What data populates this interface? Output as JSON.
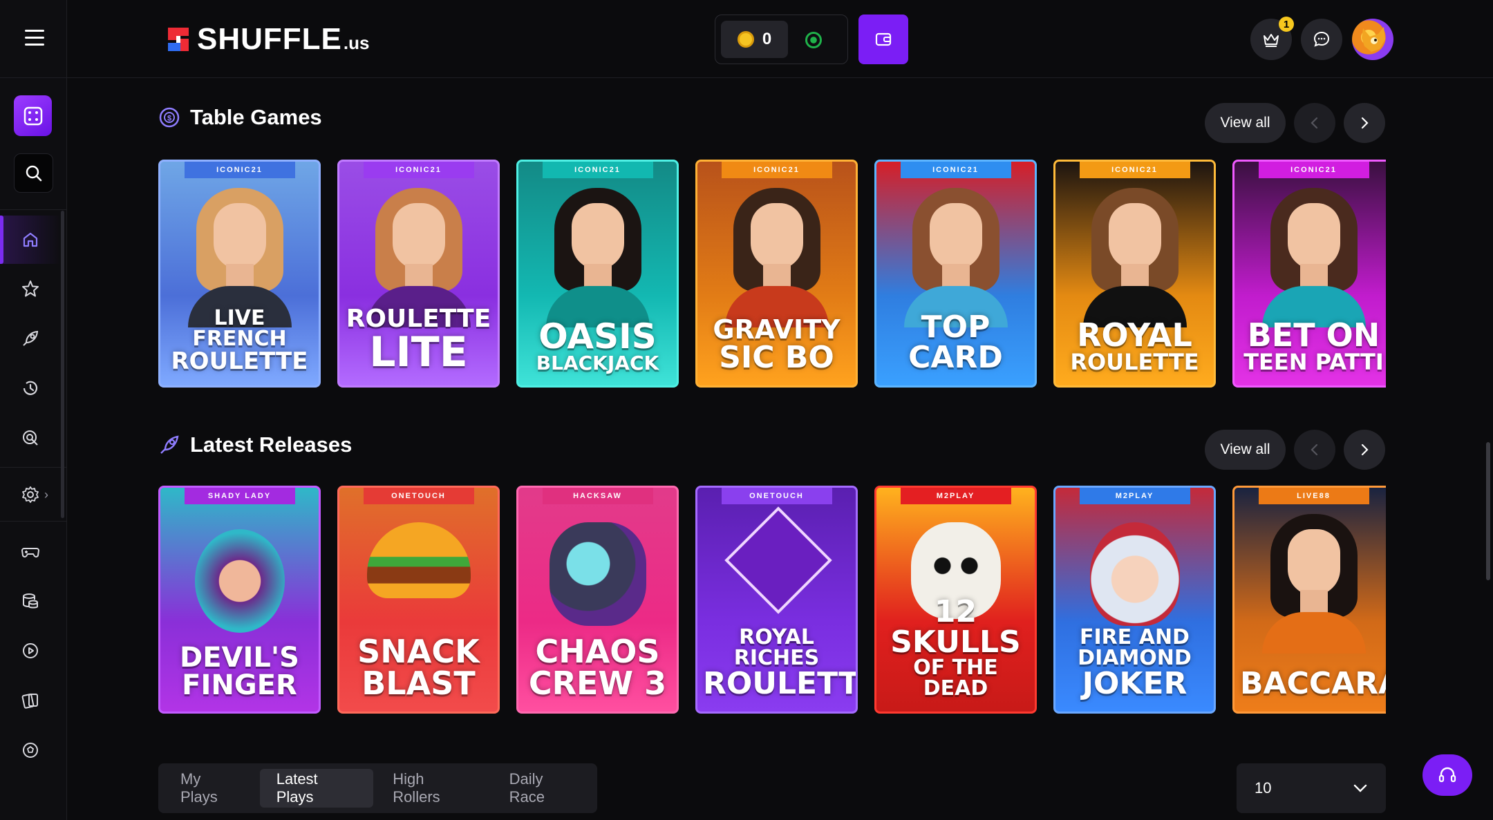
{
  "header": {
    "logo_text": "SHUFFLE",
    "logo_suffix": ".us",
    "balance": "0",
    "notifications_count": "1"
  },
  "sections": [
    {
      "title": "Table Games",
      "view_all": "View all",
      "icon": "casino-chip-icon",
      "games": [
        {
          "provider": "ICONIC21",
          "line1": "Live French",
          "line2": "Roulette",
          "colors": [
            "#6fa6e6",
            "#4c6fd8",
            "#7fa9ff"
          ],
          "border": "#8fb1ff",
          "tag": "#3f72e0",
          "hair": "#d9a063",
          "top": "#2a2f3d"
        },
        {
          "provider": "ICONIC21",
          "line1": "Roulette",
          "line2": "Lite",
          "colors": [
            "#9a4de6",
            "#8a2fe0",
            "#b36bff"
          ],
          "border": "#c07bff",
          "tag": "#9a3cf0",
          "hair": "#c97f4a",
          "top": "#5a1f8a"
        },
        {
          "provider": "ICONIC21",
          "line1": "Oasis",
          "line2": "Blackjack",
          "colors": [
            "#138a86",
            "#13b8b2",
            "#3fe3d8"
          ],
          "border": "#4ff0e4",
          "tag": "#12b8b0",
          "hair": "#1b1412",
          "top": "#0f8f8a"
        },
        {
          "provider": "ICONIC21",
          "line1": "Gravity",
          "line2": "Sic Bo",
          "colors": [
            "#b8521a",
            "#e27c16",
            "#ffa21e"
          ],
          "border": "#ffb236",
          "tag": "#f08a14",
          "hair": "#3a2418",
          "top": "#c83a1c"
        },
        {
          "provider": "ICONIC21",
          "line1": "Top Card",
          "line2": "",
          "colors": [
            "#d61f27",
            "#2f7ee0",
            "#3aa0ff"
          ],
          "border": "#5db5ff",
          "tag": "#2f8ef0",
          "hair": "#8a5030",
          "top": "#3fa8d8"
        },
        {
          "provider": "ICONIC21",
          "line1": "Royal",
          "line2": "Roulette",
          "colors": [
            "#1c1410",
            "#e48a12",
            "#ffab1e"
          ],
          "border": "#ffbb3a",
          "tag": "#f39a14",
          "hair": "#7a4a28",
          "top": "#111"
        },
        {
          "provider": "ICONIC21",
          "line1": "Bet On",
          "line2": "Teen Patti",
          "colors": [
            "#3a1040",
            "#c11ccd",
            "#e332e6"
          ],
          "border": "#f05aff",
          "tag": "#d11ee0",
          "hair": "#4a2a1e",
          "top": "#1aa5b5"
        }
      ]
    },
    {
      "title": "Latest Releases",
      "view_all": "View all",
      "icon": "rocket-icon",
      "games": [
        {
          "provider": "SHADY LADY",
          "line1": "Devil's",
          "line2": "Finger",
          "colors": [
            "#2fb8c8",
            "#8a2fd8",
            "#b234e6"
          ],
          "border": "#c25cff",
          "tag": "#a32be0"
        },
        {
          "provider": "ONETOUCH",
          "line1": "Snack",
          "line2": "Blast",
          "colors": [
            "#e0702a",
            "#ea3a3a",
            "#f24b4b"
          ],
          "border": "#ff6a5a",
          "tag": "#e53b35"
        },
        {
          "provider": "HACKSAW",
          "line1": "Chaos",
          "line2": "Crew 3",
          "colors": [
            "#e23b8a",
            "#ec2a86",
            "#ff4fa0"
          ],
          "border": "#ff6ab0",
          "tag": "#e0307f"
        },
        {
          "provider": "ONETOUCH",
          "line1": "Royal Riches",
          "line2": "Roulette",
          "colors": [
            "#5a1fb0",
            "#7a2ee0",
            "#8a3cf0"
          ],
          "border": "#a56bff",
          "tag": "#8a40ee"
        },
        {
          "provider": "M2PLAY",
          "line1": "12 Skulls",
          "line2": "of the Dead",
          "colors": [
            "#ffb21e",
            "#e0201e",
            "#c81a18"
          ],
          "border": "#ff3a30",
          "tag": "#e41f22"
        },
        {
          "provider": "M2PLAY",
          "line1": "Fire and Diamond",
          "line2": "Joker",
          "colors": [
            "#c42a3a",
            "#2f6fe0",
            "#3a8aff"
          ],
          "border": "#6aa8ff",
          "tag": "#2f7ae8"
        },
        {
          "provider": "LIVE88",
          "line1": "Baccarat",
          "line2": "",
          "colors": [
            "#1a2340",
            "#d26a18",
            "#ee7d1a"
          ],
          "border": "#ff9a3a",
          "tag": "#ec7a16"
        }
      ]
    }
  ],
  "tabs": [
    "My Plays",
    "Latest Plays",
    "High Rollers",
    "Daily Race"
  ],
  "active_tab": "Latest Plays",
  "rows_select": "10",
  "accent": "#7b1ef5"
}
